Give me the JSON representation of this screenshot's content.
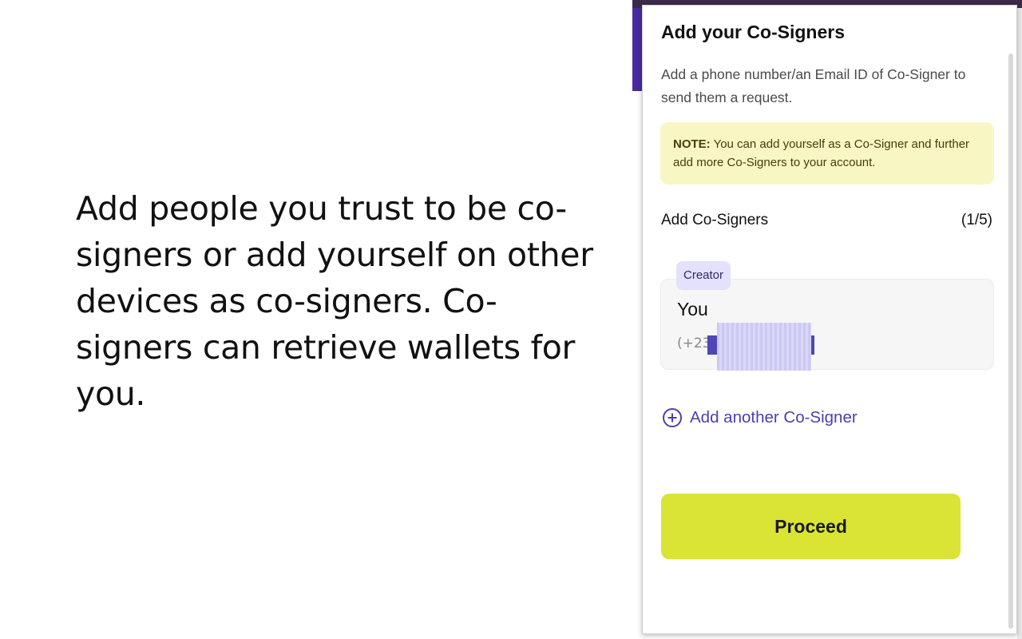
{
  "slide": {
    "text": "Add people you trust to be co-signers or add yourself on other devices as co-signers. Co-signers can retrieve wallets for you."
  },
  "dialog": {
    "title": "Add your Co-Signers",
    "description": "Add a phone number/an Email ID of Co-Signer to send them a request.",
    "note_prefix": "NOTE:",
    "note_text": " You can add yourself as a Co-Signer and further add more Co-Signers to your account.",
    "cosigners_label": "Add Co-Signers",
    "cosigners_count": "(1/5)",
    "signer": {
      "badge": "Creator",
      "name": "You",
      "phone_prefix": "(+234"
    },
    "add_another_label": "Add another Co-Signer",
    "proceed_label": "Proceed"
  },
  "colors": {
    "accent": "#4b3fb0",
    "proceed_bg": "#d9e435",
    "note_bg": "#f8f6c2",
    "badge_bg": "#e3e1fb"
  }
}
